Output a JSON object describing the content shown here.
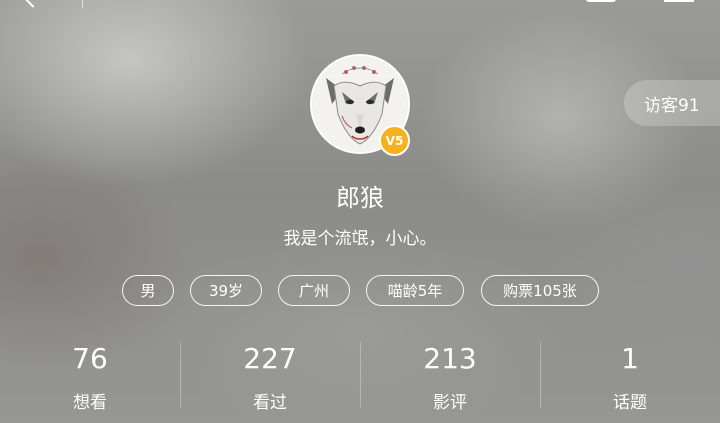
{
  "header": {
    "back_icon": "back-chevron-icon",
    "share_icon": "share-icon",
    "more_icon": "more-icon"
  },
  "visitor": {
    "label": "访客91"
  },
  "profile": {
    "avatar_icon": "wolf-avatar",
    "vip_badge": "V5",
    "nickname": "郎狼",
    "signature": "我是个流氓，小心。"
  },
  "tags": {
    "gender": "男",
    "age": "39岁",
    "city": "广州",
    "member_years": "喵龄5年",
    "tickets": "购票105张"
  },
  "stats": [
    {
      "value": "76",
      "label": "想看"
    },
    {
      "value": "227",
      "label": "看过"
    },
    {
      "value": "213",
      "label": "影评"
    },
    {
      "value": "1",
      "label": "话题"
    }
  ],
  "colors": {
    "vip_badge": "#f5b21d",
    "text": "#ffffff"
  }
}
